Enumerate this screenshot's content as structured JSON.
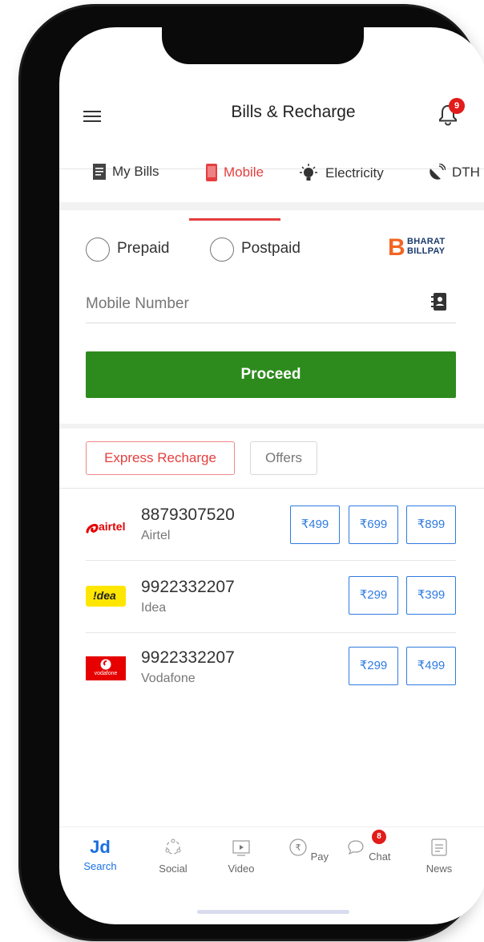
{
  "header": {
    "title": "Bills & Recharge",
    "notification_count": "9"
  },
  "tabs": [
    {
      "label": "My Bills",
      "icon": "bill-icon"
    },
    {
      "label": "Mobile",
      "icon": "mobile-icon",
      "active": true
    },
    {
      "label": "Electricity",
      "icon": "bulb-icon"
    },
    {
      "label": "DTH",
      "icon": "dish-icon"
    }
  ],
  "form": {
    "prepaid_label": "Prepaid",
    "postpaid_label": "Postpaid",
    "bbps_line1": "BHARAT",
    "bbps_line2": "BILLPAY",
    "mobile_placeholder": "Mobile Number",
    "proceed_label": "Proceed"
  },
  "chips": {
    "express": "Express Recharge",
    "offers": "Offers"
  },
  "recent": [
    {
      "number": "8879307520",
      "operator": "Airtel",
      "logo": "airtel",
      "plans": [
        "₹499",
        "₹699",
        "₹899"
      ]
    },
    {
      "number": "9922332207",
      "operator": "Idea",
      "logo": "idea",
      "plans": [
        "₹299",
        "₹399"
      ]
    },
    {
      "number": "9922332207",
      "operator": "Vodafone",
      "logo": "vodafone",
      "plans": [
        "₹299",
        "₹499"
      ]
    }
  ],
  "logos": {
    "airtel_text": "airtel",
    "idea_text": "!dea",
    "vodafone_text": "vodafone"
  },
  "bottom_nav": [
    {
      "label": "Search",
      "icon": "jd-logo",
      "active": true
    },
    {
      "label": "Social",
      "icon": "social-icon"
    },
    {
      "label": "Video",
      "icon": "video-icon"
    },
    {
      "label": "Pay",
      "icon": "rupee-icon"
    },
    {
      "label": "Chat",
      "icon": "chat-icon",
      "badge": "8"
    },
    {
      "label": "News",
      "icon": "news-icon"
    }
  ],
  "jd_logo_text": "Jd",
  "colors": {
    "accent_red": "#e53e3e",
    "proceed_green": "#2d8b1d",
    "plan_blue": "#2f7be0",
    "nav_active": "#1a6fe0"
  }
}
